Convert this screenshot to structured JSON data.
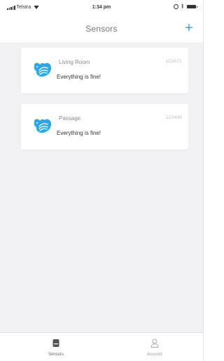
{
  "status_bar": {
    "carrier": "Telstra",
    "time": "1:34 pm",
    "icons": [
      "signal-icon",
      "wifi-icon",
      "rotation-lock-icon",
      "bluetooth-icon",
      "battery-icon"
    ]
  },
  "nav": {
    "title": "Sensors",
    "add_label": "+"
  },
  "sensors": [
    {
      "name": "Living Room",
      "id": "1C0A71",
      "status": "Everything is fine!",
      "icon": "bird-logo-icon"
    },
    {
      "name": "Passage",
      "id": "1C0434",
      "status": "Everything is fine!",
      "icon": "bird-logo-icon"
    }
  ],
  "tabs": [
    {
      "label": "Sensors",
      "icon": "sensor-icon",
      "active": true
    },
    {
      "label": "Account",
      "icon": "person-icon",
      "active": false
    }
  ],
  "colors": {
    "accent": "#29a9e8",
    "background": "#f2f2f4",
    "card": "#ffffff",
    "text_primary": "#333333",
    "text_secondary": "#8a8a8a"
  }
}
